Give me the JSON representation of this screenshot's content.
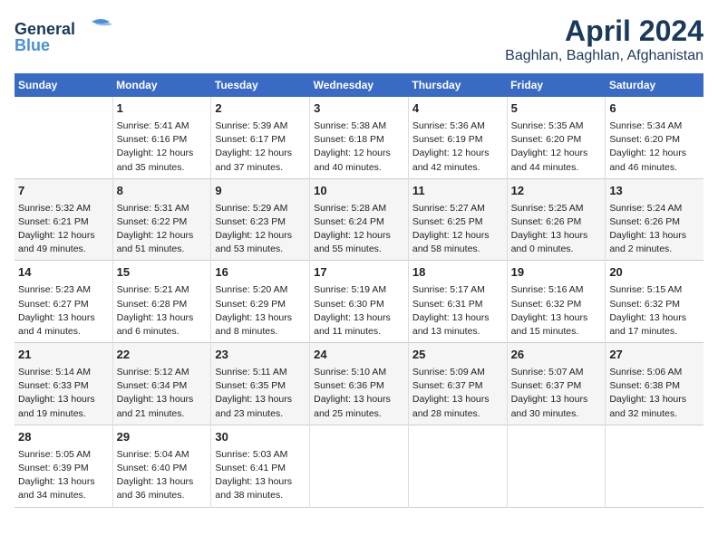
{
  "logo": {
    "line1": "General",
    "line2": "Blue"
  },
  "title": "April 2024",
  "subtitle": "Baghlan, Baghlan, Afghanistan",
  "days_header": [
    "Sunday",
    "Monday",
    "Tuesday",
    "Wednesday",
    "Thursday",
    "Friday",
    "Saturday"
  ],
  "weeks": [
    [
      {
        "day": "",
        "content": ""
      },
      {
        "day": "1",
        "content": "Sunrise: 5:41 AM\nSunset: 6:16 PM\nDaylight: 12 hours\nand 35 minutes."
      },
      {
        "day": "2",
        "content": "Sunrise: 5:39 AM\nSunset: 6:17 PM\nDaylight: 12 hours\nand 37 minutes."
      },
      {
        "day": "3",
        "content": "Sunrise: 5:38 AM\nSunset: 6:18 PM\nDaylight: 12 hours\nand 40 minutes."
      },
      {
        "day": "4",
        "content": "Sunrise: 5:36 AM\nSunset: 6:19 PM\nDaylight: 12 hours\nand 42 minutes."
      },
      {
        "day": "5",
        "content": "Sunrise: 5:35 AM\nSunset: 6:20 PM\nDaylight: 12 hours\nand 44 minutes."
      },
      {
        "day": "6",
        "content": "Sunrise: 5:34 AM\nSunset: 6:20 PM\nDaylight: 12 hours\nand 46 minutes."
      }
    ],
    [
      {
        "day": "7",
        "content": "Sunrise: 5:32 AM\nSunset: 6:21 PM\nDaylight: 12 hours\nand 49 minutes."
      },
      {
        "day": "8",
        "content": "Sunrise: 5:31 AM\nSunset: 6:22 PM\nDaylight: 12 hours\nand 51 minutes."
      },
      {
        "day": "9",
        "content": "Sunrise: 5:29 AM\nSunset: 6:23 PM\nDaylight: 12 hours\nand 53 minutes."
      },
      {
        "day": "10",
        "content": "Sunrise: 5:28 AM\nSunset: 6:24 PM\nDaylight: 12 hours\nand 55 minutes."
      },
      {
        "day": "11",
        "content": "Sunrise: 5:27 AM\nSunset: 6:25 PM\nDaylight: 12 hours\nand 58 minutes."
      },
      {
        "day": "12",
        "content": "Sunrise: 5:25 AM\nSunset: 6:26 PM\nDaylight: 13 hours\nand 0 minutes."
      },
      {
        "day": "13",
        "content": "Sunrise: 5:24 AM\nSunset: 6:26 PM\nDaylight: 13 hours\nand 2 minutes."
      }
    ],
    [
      {
        "day": "14",
        "content": "Sunrise: 5:23 AM\nSunset: 6:27 PM\nDaylight: 13 hours\nand 4 minutes."
      },
      {
        "day": "15",
        "content": "Sunrise: 5:21 AM\nSunset: 6:28 PM\nDaylight: 13 hours\nand 6 minutes."
      },
      {
        "day": "16",
        "content": "Sunrise: 5:20 AM\nSunset: 6:29 PM\nDaylight: 13 hours\nand 8 minutes."
      },
      {
        "day": "17",
        "content": "Sunrise: 5:19 AM\nSunset: 6:30 PM\nDaylight: 13 hours\nand 11 minutes."
      },
      {
        "day": "18",
        "content": "Sunrise: 5:17 AM\nSunset: 6:31 PM\nDaylight: 13 hours\nand 13 minutes."
      },
      {
        "day": "19",
        "content": "Sunrise: 5:16 AM\nSunset: 6:32 PM\nDaylight: 13 hours\nand 15 minutes."
      },
      {
        "day": "20",
        "content": "Sunrise: 5:15 AM\nSunset: 6:32 PM\nDaylight: 13 hours\nand 17 minutes."
      }
    ],
    [
      {
        "day": "21",
        "content": "Sunrise: 5:14 AM\nSunset: 6:33 PM\nDaylight: 13 hours\nand 19 minutes."
      },
      {
        "day": "22",
        "content": "Sunrise: 5:12 AM\nSunset: 6:34 PM\nDaylight: 13 hours\nand 21 minutes."
      },
      {
        "day": "23",
        "content": "Sunrise: 5:11 AM\nSunset: 6:35 PM\nDaylight: 13 hours\nand 23 minutes."
      },
      {
        "day": "24",
        "content": "Sunrise: 5:10 AM\nSunset: 6:36 PM\nDaylight: 13 hours\nand 25 minutes."
      },
      {
        "day": "25",
        "content": "Sunrise: 5:09 AM\nSunset: 6:37 PM\nDaylight: 13 hours\nand 28 minutes."
      },
      {
        "day": "26",
        "content": "Sunrise: 5:07 AM\nSunset: 6:37 PM\nDaylight: 13 hours\nand 30 minutes."
      },
      {
        "day": "27",
        "content": "Sunrise: 5:06 AM\nSunset: 6:38 PM\nDaylight: 13 hours\nand 32 minutes."
      }
    ],
    [
      {
        "day": "28",
        "content": "Sunrise: 5:05 AM\nSunset: 6:39 PM\nDaylight: 13 hours\nand 34 minutes."
      },
      {
        "day": "29",
        "content": "Sunrise: 5:04 AM\nSunset: 6:40 PM\nDaylight: 13 hours\nand 36 minutes."
      },
      {
        "day": "30",
        "content": "Sunrise: 5:03 AM\nSunset: 6:41 PM\nDaylight: 13 hours\nand 38 minutes."
      },
      {
        "day": "",
        "content": ""
      },
      {
        "day": "",
        "content": ""
      },
      {
        "day": "",
        "content": ""
      },
      {
        "day": "",
        "content": ""
      }
    ]
  ]
}
